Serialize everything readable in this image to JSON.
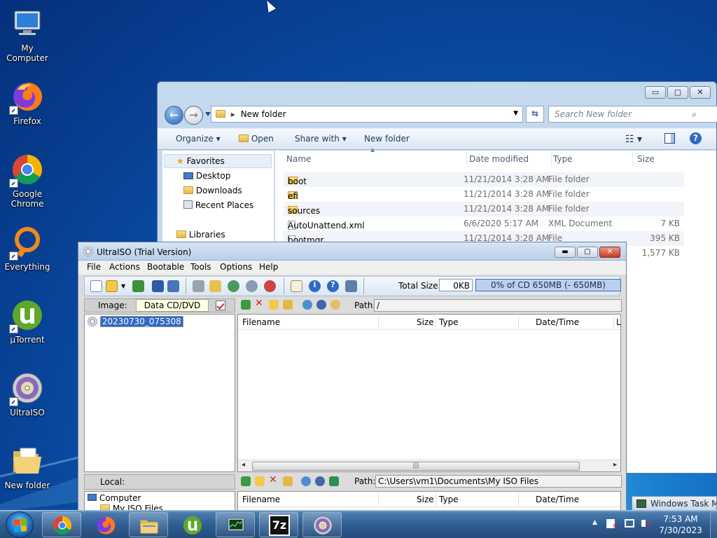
{
  "desktop": {
    "icons": [
      {
        "label": "My Computer",
        "icon": "computer-icon"
      },
      {
        "label": "Firefox",
        "icon": "firefox-icon"
      },
      {
        "label": "Google Chrome",
        "icon": "chrome-icon"
      },
      {
        "label": "Everything",
        "icon": "everything-icon"
      },
      {
        "label": "µTorrent",
        "icon": "utorrent-icon"
      },
      {
        "label": "UltraISO",
        "icon": "ultraiso-icon"
      },
      {
        "label": "New folder",
        "icon": "folder-icon"
      }
    ]
  },
  "explorer": {
    "caption_buttons": {
      "minimize": "▭",
      "maximize": "▢",
      "close": "✕"
    },
    "address": {
      "arrow": "▸",
      "path": "New folder"
    },
    "search_placeholder": "Search New folder",
    "toolbar": {
      "organize": "Organize ▾",
      "open": "Open",
      "share_with": "Share with ▾",
      "new_folder": "New folder"
    },
    "nav": {
      "favorites": "Favorites",
      "desktop": "Desktop",
      "downloads": "Downloads",
      "recent_places": "Recent Places",
      "libraries": "Libraries"
    },
    "columns": {
      "name": "Name",
      "date": "Date modified",
      "type": "Type",
      "size": "Size"
    },
    "files": [
      {
        "name": "boot",
        "date": "11/21/2014 3:28 AM",
        "type": "File folder",
        "size": "",
        "icon": "folder-icon"
      },
      {
        "name": "efi",
        "date": "11/21/2014 3:28 AM",
        "type": "File folder",
        "size": "",
        "icon": "folder-icon"
      },
      {
        "name": "sources",
        "date": "11/21/2014 3:28 AM",
        "type": "File folder",
        "size": "",
        "icon": "folder-icon"
      },
      {
        "name": "AutoUnattend.xml",
        "date": "6/6/2020 5:17 AM",
        "type": "XML Document",
        "size": "7 KB",
        "icon": "xml-file-icon"
      },
      {
        "name": "bootmgr",
        "date": "11/21/2014 3:28 AM",
        "type": "File",
        "size": "395 KB",
        "icon": "file-icon"
      },
      {
        "name": "",
        "date": "",
        "type": "",
        "size": "1,577 KB",
        "icon": "file-icon"
      }
    ]
  },
  "ultraiso": {
    "title": "UltraISO (Trial Version)",
    "menu": [
      "File",
      "Actions",
      "Bootable",
      "Tools",
      "Options",
      "Help"
    ],
    "total_size_label": "Total Size:",
    "total_size_value": "0KB",
    "cd_capacity": "0% of CD 650MB (- 650MB)",
    "image_label": "Image:",
    "image_type": "Data CD/DVD",
    "path_label": "Path:",
    "iso_path": "/",
    "tree_root": "20230730_075308",
    "columns": {
      "filename": "Filename",
      "size": "Size",
      "type": "Type",
      "datetime": "Date/Time",
      "extra": "L"
    },
    "local_label": "Local:",
    "local_path": "C:\\Users\\vm1\\Documents\\My ISO Files",
    "local_tree": [
      "Computer",
      "My ISO Files"
    ]
  },
  "task_manager_peek": "Windows Task Ma",
  "taskbar": {
    "apps": [
      "chrome-icon",
      "firefox-icon",
      "explorer-icon",
      "utorrent-icon",
      "task-manager-icon",
      "7zip-icon",
      "ultraiso-icon"
    ],
    "seven_zip_label": "7z",
    "tray_arrow": "▲",
    "time": "7:53 AM",
    "date": "7/30/2023"
  }
}
